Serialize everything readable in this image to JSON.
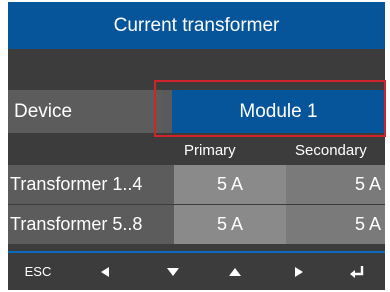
{
  "title": "Current transformer",
  "device": {
    "label": "Device",
    "value": "Module 1"
  },
  "columns": {
    "primary": "Primary",
    "secondary": "Secondary"
  },
  "transformers": [
    {
      "label": "Transformer 1..4",
      "primary": "5 A",
      "secondary": "5 A"
    },
    {
      "label": "Transformer 5..8",
      "primary": "5 A",
      "secondary": "5 A"
    }
  ],
  "softkeys": [
    {
      "label": "ESC",
      "icon": "esc-text"
    },
    {
      "label": "",
      "icon": "arrow-left-icon"
    },
    {
      "label": "",
      "icon": "arrow-down-icon"
    },
    {
      "label": "",
      "icon": "arrow-up-icon"
    },
    {
      "label": "",
      "icon": "arrow-right-icon"
    },
    {
      "label": "",
      "icon": "enter-icon"
    }
  ],
  "colors": {
    "accent": "#06559a",
    "focus": "#d1232a",
    "background": "#3c3c3c"
  }
}
